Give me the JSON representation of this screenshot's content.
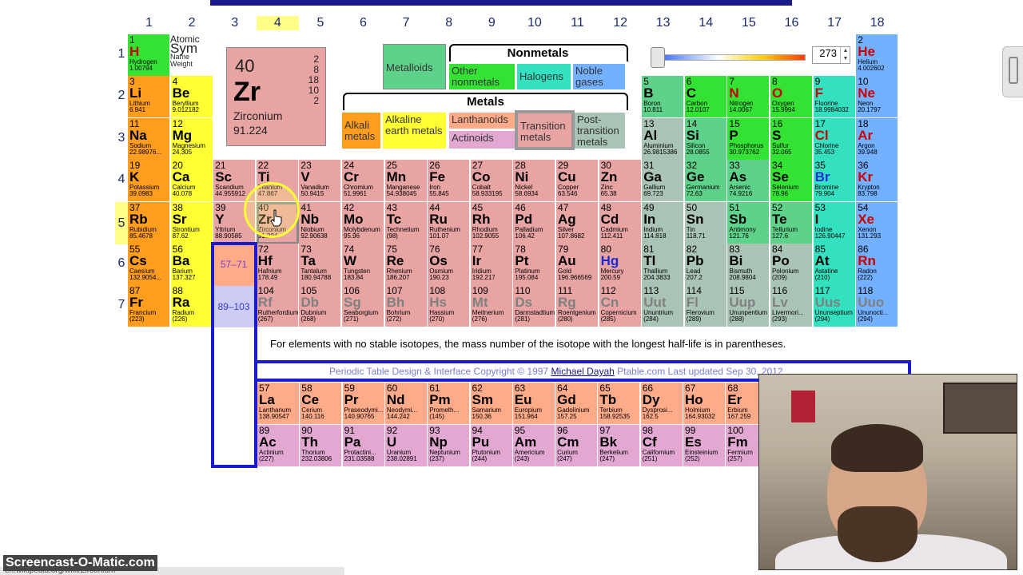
{
  "groups": [
    "1",
    "2",
    "3",
    "4",
    "5",
    "6",
    "7",
    "8",
    "9",
    "10",
    "11",
    "12",
    "13",
    "14",
    "15",
    "16",
    "17",
    "18"
  ],
  "periods": [
    "1",
    "2",
    "3",
    "4",
    "5",
    "6",
    "7"
  ],
  "selected": {
    "number": "40",
    "symbol": "Zr",
    "name": "Zirconium",
    "weight": "91.224",
    "shells": [
      "2",
      "8",
      "18",
      "10",
      "2"
    ]
  },
  "key": {
    "l1": "Atomic",
    "l2": "Sym",
    "l3": "Name",
    "l4": "Weight"
  },
  "legend": {
    "metalloids": "Metalloids",
    "nonmetals_title": "Nonmetals",
    "other_nonmetals": "Other nonmetals",
    "halogens": "Halogens",
    "noble": "Noble gases",
    "metals_title": "Metals",
    "alkali": "Alkali metals",
    "alkaline": "Alkaline earth metals",
    "lanthanoids": "Lanthanoids",
    "actinoids": "Actinoids",
    "transition": "Transition metals",
    "post": "Post-transition metals"
  },
  "temperature": "273",
  "note": "For elements with no stable isotopes, the mass number of the isotope with the longest half-life is in parentheses.",
  "copyright": {
    "prefix": "Periodic Table Design & Interface Copyright © 1997",
    "author": "Michael Dayah",
    "suffix": "Ptable.com Last updated Sep 30, 2012"
  },
  "ranges": {
    "lanth": "57–71",
    "actin": "89–103"
  },
  "watermark": "Screencast-O-Matic.com",
  "status_url": "en.wikipedia.org/wiki/Zirconium",
  "elements": [
    {
      "n": "1",
      "s": "H",
      "nm": "Hydrogen",
      "w": "1.00794",
      "g": 1,
      "p": 1,
      "c": "hyd",
      "t": "red"
    },
    {
      "n": "2",
      "s": "He",
      "nm": "Helium",
      "w": "4.002602",
      "g": 18,
      "p": 1,
      "c": "noble",
      "t": "red"
    },
    {
      "n": "3",
      "s": "Li",
      "nm": "Lithium",
      "w": "6.941",
      "g": 1,
      "p": 2,
      "c": "alkali"
    },
    {
      "n": "4",
      "s": "Be",
      "nm": "Beryllium",
      "w": "9.012182",
      "g": 2,
      "p": 2,
      "c": "alkaline"
    },
    {
      "n": "5",
      "s": "B",
      "nm": "Boron",
      "w": "10.811",
      "g": 13,
      "p": 2,
      "c": "metalloid"
    },
    {
      "n": "6",
      "s": "C",
      "nm": "Carbon",
      "w": "12.0107",
      "g": 14,
      "p": 2,
      "c": "nonmetal"
    },
    {
      "n": "7",
      "s": "N",
      "nm": "Nitrogen",
      "w": "14.0067",
      "g": 15,
      "p": 2,
      "c": "nonmetal",
      "t": "red"
    },
    {
      "n": "8",
      "s": "O",
      "nm": "Oxygen",
      "w": "15.9994",
      "g": 16,
      "p": 2,
      "c": "nonmetal",
      "t": "red"
    },
    {
      "n": "9",
      "s": "F",
      "nm": "Fluorine",
      "w": "18.9984032",
      "g": 17,
      "p": 2,
      "c": "halogen",
      "t": "red"
    },
    {
      "n": "10",
      "s": "Ne",
      "nm": "Neon",
      "w": "20.1797",
      "g": 18,
      "p": 2,
      "c": "noble",
      "t": "red"
    },
    {
      "n": "11",
      "s": "Na",
      "nm": "Sodium",
      "w": "22.98976...",
      "g": 1,
      "p": 3,
      "c": "alkali"
    },
    {
      "n": "12",
      "s": "Mg",
      "nm": "Magnesium",
      "w": "24.305",
      "g": 2,
      "p": 3,
      "c": "alkaline"
    },
    {
      "n": "13",
      "s": "Al",
      "nm": "Aluminium",
      "w": "26.9815386",
      "g": 13,
      "p": 3,
      "c": "post"
    },
    {
      "n": "14",
      "s": "Si",
      "nm": "Silicon",
      "w": "28.0855",
      "g": 14,
      "p": 3,
      "c": "metalloid"
    },
    {
      "n": "15",
      "s": "P",
      "nm": "Phosphorus",
      "w": "30.973762",
      "g": 15,
      "p": 3,
      "c": "nonmetal"
    },
    {
      "n": "16",
      "s": "S",
      "nm": "Sulfur",
      "w": "32.065",
      "g": 16,
      "p": 3,
      "c": "nonmetal"
    },
    {
      "n": "17",
      "s": "Cl",
      "nm": "Chlorine",
      "w": "35.453",
      "g": 17,
      "p": 3,
      "c": "halogen",
      "t": "red"
    },
    {
      "n": "18",
      "s": "Ar",
      "nm": "Argon",
      "w": "39.948",
      "g": 18,
      "p": 3,
      "c": "noble",
      "t": "red"
    },
    {
      "n": "19",
      "s": "K",
      "nm": "Potassium",
      "w": "39.0983",
      "g": 1,
      "p": 4,
      "c": "alkali"
    },
    {
      "n": "20",
      "s": "Ca",
      "nm": "Calcium",
      "w": "40.078",
      "g": 2,
      "p": 4,
      "c": "alkaline"
    },
    {
      "n": "21",
      "s": "Sc",
      "nm": "Scandium",
      "w": "44.955912",
      "g": 3,
      "p": 4,
      "c": "trans"
    },
    {
      "n": "22",
      "s": "Ti",
      "nm": "Titanium",
      "w": "47.867",
      "g": 4,
      "p": 4,
      "c": "trans"
    },
    {
      "n": "23",
      "s": "V",
      "nm": "Vanadium",
      "w": "50.9415",
      "g": 5,
      "p": 4,
      "c": "trans"
    },
    {
      "n": "24",
      "s": "Cr",
      "nm": "Chromium",
      "w": "51.9961",
      "g": 6,
      "p": 4,
      "c": "trans"
    },
    {
      "n": "25",
      "s": "Mn",
      "nm": "Manganese",
      "w": "54.938045",
      "g": 7,
      "p": 4,
      "c": "trans"
    },
    {
      "n": "26",
      "s": "Fe",
      "nm": "Iron",
      "w": "55.845",
      "g": 8,
      "p": 4,
      "c": "trans"
    },
    {
      "n": "27",
      "s": "Co",
      "nm": "Cobalt",
      "w": "58.933195",
      "g": 9,
      "p": 4,
      "c": "trans"
    },
    {
      "n": "28",
      "s": "Ni",
      "nm": "Nickel",
      "w": "58.6934",
      "g": 10,
      "p": 4,
      "c": "trans"
    },
    {
      "n": "29",
      "s": "Cu",
      "nm": "Copper",
      "w": "63.546",
      "g": 11,
      "p": 4,
      "c": "trans"
    },
    {
      "n": "30",
      "s": "Zn",
      "nm": "Zinc",
      "w": "65.38",
      "g": 12,
      "p": 4,
      "c": "trans"
    },
    {
      "n": "31",
      "s": "Ga",
      "nm": "Gallium",
      "w": "69.723",
      "g": 13,
      "p": 4,
      "c": "post"
    },
    {
      "n": "32",
      "s": "Ge",
      "nm": "Germanium",
      "w": "72.63",
      "g": 14,
      "p": 4,
      "c": "metalloid"
    },
    {
      "n": "33",
      "s": "As",
      "nm": "Arsenic",
      "w": "74.9216",
      "g": 15,
      "p": 4,
      "c": "metalloid"
    },
    {
      "n": "34",
      "s": "Se",
      "nm": "Selenium",
      "w": "78.96",
      "g": 16,
      "p": 4,
      "c": "nonmetal"
    },
    {
      "n": "35",
      "s": "Br",
      "nm": "Bromine",
      "w": "79.904",
      "g": 17,
      "p": 4,
      "c": "halogen",
      "t": "blue"
    },
    {
      "n": "36",
      "s": "Kr",
      "nm": "Krypton",
      "w": "83.798",
      "g": 18,
      "p": 4,
      "c": "noble",
      "t": "red"
    },
    {
      "n": "37",
      "s": "Rb",
      "nm": "Rubidium",
      "w": "85.4678",
      "g": 1,
      "p": 5,
      "c": "alkali"
    },
    {
      "n": "38",
      "s": "Sr",
      "nm": "Strontium",
      "w": "87.62",
      "g": 2,
      "p": 5,
      "c": "alkaline"
    },
    {
      "n": "39",
      "s": "Y",
      "nm": "Yttrium",
      "w": "88.90585",
      "g": 3,
      "p": 5,
      "c": "trans"
    },
    {
      "n": "40",
      "s": "Zr",
      "nm": "Zirconium",
      "w": "91.224",
      "g": 4,
      "p": 5,
      "c": "trans"
    },
    {
      "n": "41",
      "s": "Nb",
      "nm": "Niobium",
      "w": "92.90638",
      "g": 5,
      "p": 5,
      "c": "trans"
    },
    {
      "n": "42",
      "s": "Mo",
      "nm": "Molybdenum",
      "w": "95.96",
      "g": 6,
      "p": 5,
      "c": "trans"
    },
    {
      "n": "43",
      "s": "Tc",
      "nm": "Technetium",
      "w": "(98)",
      "g": 7,
      "p": 5,
      "c": "trans"
    },
    {
      "n": "44",
      "s": "Ru",
      "nm": "Ruthenium",
      "w": "101.07",
      "g": 8,
      "p": 5,
      "c": "trans"
    },
    {
      "n": "45",
      "s": "Rh",
      "nm": "Rhodium",
      "w": "102.9055",
      "g": 9,
      "p": 5,
      "c": "trans"
    },
    {
      "n": "46",
      "s": "Pd",
      "nm": "Palladium",
      "w": "106.42",
      "g": 10,
      "p": 5,
      "c": "trans"
    },
    {
      "n": "47",
      "s": "Ag",
      "nm": "Silver",
      "w": "107.8682",
      "g": 11,
      "p": 5,
      "c": "trans"
    },
    {
      "n": "48",
      "s": "Cd",
      "nm": "Cadmium",
      "w": "112.411",
      "g": 12,
      "p": 5,
      "c": "trans"
    },
    {
      "n": "49",
      "s": "In",
      "nm": "Indium",
      "w": "114.818",
      "g": 13,
      "p": 5,
      "c": "post"
    },
    {
      "n": "50",
      "s": "Sn",
      "nm": "Tin",
      "w": "118.71",
      "g": 14,
      "p": 5,
      "c": "post"
    },
    {
      "n": "51",
      "s": "Sb",
      "nm": "Antimony",
      "w": "121.76",
      "g": 15,
      "p": 5,
      "c": "metalloid"
    },
    {
      "n": "52",
      "s": "Te",
      "nm": "Tellurium",
      "w": "127.6",
      "g": 16,
      "p": 5,
      "c": "metalloid"
    },
    {
      "n": "53",
      "s": "I",
      "nm": "Iodine",
      "w": "126.90447",
      "g": 17,
      "p": 5,
      "c": "halogen"
    },
    {
      "n": "54",
      "s": "Xe",
      "nm": "Xenon",
      "w": "131.293",
      "g": 18,
      "p": 5,
      "c": "noble",
      "t": "red"
    },
    {
      "n": "55",
      "s": "Cs",
      "nm": "Caesium",
      "w": "132.9054...",
      "g": 1,
      "p": 6,
      "c": "alkali"
    },
    {
      "n": "56",
      "s": "Ba",
      "nm": "Barium",
      "w": "137.327",
      "g": 2,
      "p": 6,
      "c": "alkaline"
    },
    {
      "n": "72",
      "s": "Hf",
      "nm": "Hafnium",
      "w": "178.49",
      "g": 4,
      "p": 6,
      "c": "trans"
    },
    {
      "n": "73",
      "s": "Ta",
      "nm": "Tantalum",
      "w": "180.94788",
      "g": 5,
      "p": 6,
      "c": "trans"
    },
    {
      "n": "74",
      "s": "W",
      "nm": "Tungsten",
      "w": "183.84",
      "g": 6,
      "p": 6,
      "c": "trans"
    },
    {
      "n": "75",
      "s": "Re",
      "nm": "Rhenium",
      "w": "186.207",
      "g": 7,
      "p": 6,
      "c": "trans"
    },
    {
      "n": "76",
      "s": "Os",
      "nm": "Osmium",
      "w": "190.23",
      "g": 8,
      "p": 6,
      "c": "trans"
    },
    {
      "n": "77",
      "s": "Ir",
      "nm": "Iridium",
      "w": "192.217",
      "g": 9,
      "p": 6,
      "c": "trans"
    },
    {
      "n": "78",
      "s": "Pt",
      "nm": "Platinum",
      "w": "195.084",
      "g": 10,
      "p": 6,
      "c": "trans"
    },
    {
      "n": "79",
      "s": "Au",
      "nm": "Gold",
      "w": "196.966569",
      "g": 11,
      "p": 6,
      "c": "trans"
    },
    {
      "n": "80",
      "s": "Hg",
      "nm": "Mercury",
      "w": "200.59",
      "g": 12,
      "p": 6,
      "c": "trans",
      "t": "blue"
    },
    {
      "n": "81",
      "s": "Tl",
      "nm": "Thallium",
      "w": "204.3833",
      "g": 13,
      "p": 6,
      "c": "post"
    },
    {
      "n": "82",
      "s": "Pb",
      "nm": "Lead",
      "w": "207.2",
      "g": 14,
      "p": 6,
      "c": "post"
    },
    {
      "n": "83",
      "s": "Bi",
      "nm": "Bismuth",
      "w": "208.9804",
      "g": 15,
      "p": 6,
      "c": "post"
    },
    {
      "n": "84",
      "s": "Po",
      "nm": "Polonium",
      "w": "(209)",
      "g": 16,
      "p": 6,
      "c": "post"
    },
    {
      "n": "85",
      "s": "At",
      "nm": "Astatine",
      "w": "(210)",
      "g": 17,
      "p": 6,
      "c": "halogen"
    },
    {
      "n": "86",
      "s": "Rn",
      "nm": "Radon",
      "w": "(222)",
      "g": 18,
      "p": 6,
      "c": "noble",
      "t": "red"
    },
    {
      "n": "87",
      "s": "Fr",
      "nm": "Francium",
      "w": "(223)",
      "g": 1,
      "p": 7,
      "c": "alkali"
    },
    {
      "n": "88",
      "s": "Ra",
      "nm": "Radium",
      "w": "(226)",
      "g": 2,
      "p": 7,
      "c": "alkaline"
    },
    {
      "n": "104",
      "s": "Rf",
      "nm": "Rutherfordium",
      "w": "(267)",
      "g": 4,
      "p": 7,
      "c": "trans",
      "t": "grey"
    },
    {
      "n": "105",
      "s": "Db",
      "nm": "Dubnium",
      "w": "(268)",
      "g": 5,
      "p": 7,
      "c": "trans",
      "t": "grey"
    },
    {
      "n": "106",
      "s": "Sg",
      "nm": "Seaborgium",
      "w": "(271)",
      "g": 6,
      "p": 7,
      "c": "trans",
      "t": "grey"
    },
    {
      "n": "107",
      "s": "Bh",
      "nm": "Bohrium",
      "w": "(272)",
      "g": 7,
      "p": 7,
      "c": "trans",
      "t": "grey"
    },
    {
      "n": "108",
      "s": "Hs",
      "nm": "Hassium",
      "w": "(270)",
      "g": 8,
      "p": 7,
      "c": "trans",
      "t": "grey"
    },
    {
      "n": "109",
      "s": "Mt",
      "nm": "Meitnerium",
      "w": "(276)",
      "g": 9,
      "p": 7,
      "c": "trans",
      "t": "grey"
    },
    {
      "n": "110",
      "s": "Ds",
      "nm": "Darmstadtium",
      "w": "(281)",
      "g": 10,
      "p": 7,
      "c": "trans",
      "t": "grey"
    },
    {
      "n": "111",
      "s": "Rg",
      "nm": "Roentgenium",
      "w": "(280)",
      "g": 11,
      "p": 7,
      "c": "trans",
      "t": "grey"
    },
    {
      "n": "112",
      "s": "Cn",
      "nm": "Copernicium",
      "w": "(285)",
      "g": 12,
      "p": 7,
      "c": "trans",
      "t": "grey"
    },
    {
      "n": "113",
      "s": "Uut",
      "nm": "Ununtrium",
      "w": "(284)",
      "g": 13,
      "p": 7,
      "c": "post",
      "t": "grey"
    },
    {
      "n": "114",
      "s": "Fl",
      "nm": "Flerovium",
      "w": "(289)",
      "g": 14,
      "p": 7,
      "c": "post",
      "t": "grey"
    },
    {
      "n": "115",
      "s": "Uup",
      "nm": "Ununpentium",
      "w": "(288)",
      "g": 15,
      "p": 7,
      "c": "post",
      "t": "grey"
    },
    {
      "n": "116",
      "s": "Lv",
      "nm": "Livermori...",
      "w": "(293)",
      "g": 16,
      "p": 7,
      "c": "post",
      "t": "grey"
    },
    {
      "n": "117",
      "s": "Uus",
      "nm": "Ununseptium",
      "w": "(294)",
      "g": 17,
      "p": 7,
      "c": "halogen",
      "t": "grey"
    },
    {
      "n": "118",
      "s": "Uuo",
      "nm": "Ununocti...",
      "w": "(294)",
      "g": 18,
      "p": 7,
      "c": "noble",
      "t": "grey"
    }
  ],
  "lanthanides": [
    {
      "n": "57",
      "s": "La",
      "nm": "Lanthanum",
      "w": "138.90547"
    },
    {
      "n": "58",
      "s": "Ce",
      "nm": "Cerium",
      "w": "140.116"
    },
    {
      "n": "59",
      "s": "Pr",
      "nm": "Praseodymi...",
      "w": "140.90765"
    },
    {
      "n": "60",
      "s": "Nd",
      "nm": "Neodymi...",
      "w": "144.242"
    },
    {
      "n": "61",
      "s": "Pm",
      "nm": "Prometh...",
      "w": "(145)"
    },
    {
      "n": "62",
      "s": "Sm",
      "nm": "Samarium",
      "w": "150.36"
    },
    {
      "n": "63",
      "s": "Eu",
      "nm": "Europium",
      "w": "151.964"
    },
    {
      "n": "64",
      "s": "Gd",
      "nm": "Gadolinium",
      "w": "157.25"
    },
    {
      "n": "65",
      "s": "Tb",
      "nm": "Terbium",
      "w": "158.92535"
    },
    {
      "n": "66",
      "s": "Dy",
      "nm": "Dysprosi...",
      "w": "162.5"
    },
    {
      "n": "67",
      "s": "Ho",
      "nm": "Holmium",
      "w": "164.93032"
    },
    {
      "n": "68",
      "s": "Er",
      "nm": "Erbium",
      "w": "167.259"
    }
  ],
  "actinides": [
    {
      "n": "89",
      "s": "Ac",
      "nm": "Actinium",
      "w": "(227)"
    },
    {
      "n": "90",
      "s": "Th",
      "nm": "Thorium",
      "w": "232.03806"
    },
    {
      "n": "91",
      "s": "Pa",
      "nm": "Protactini...",
      "w": "231.03588"
    },
    {
      "n": "92",
      "s": "U",
      "nm": "Uranium",
      "w": "238.02891"
    },
    {
      "n": "93",
      "s": "Np",
      "nm": "Neptunium",
      "w": "(237)"
    },
    {
      "n": "94",
      "s": "Pu",
      "nm": "Plutonium",
      "w": "(244)"
    },
    {
      "n": "95",
      "s": "Am",
      "nm": "Americium",
      "w": "(243)"
    },
    {
      "n": "96",
      "s": "Cm",
      "nm": "Curium",
      "w": "(247)"
    },
    {
      "n": "97",
      "s": "Bk",
      "nm": "Berkelium",
      "w": "(247)"
    },
    {
      "n": "98",
      "s": "Cf",
      "nm": "Californium",
      "w": "(251)"
    },
    {
      "n": "99",
      "s": "Es",
      "nm": "Einsteinium",
      "w": "(252)"
    },
    {
      "n": "100",
      "s": "Fm",
      "nm": "Fermium",
      "w": "(257)"
    }
  ]
}
